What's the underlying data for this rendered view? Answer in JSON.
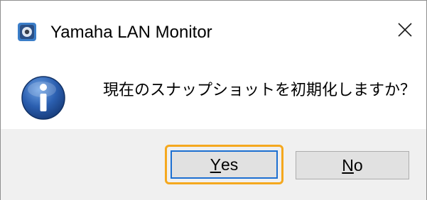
{
  "window": {
    "title": "Yamaha LAN Monitor",
    "app_icon": "yamaha-lan-monitor-app-icon",
    "close_icon": "close-x-icon"
  },
  "message": {
    "icon": "information-icon",
    "text": "現在のスナップショットを初期化しますか？"
  },
  "buttons": {
    "yes": {
      "mnemonic": "Y",
      "rest": "es"
    },
    "no": {
      "mnemonic": "N",
      "rest": "o"
    }
  },
  "colors": {
    "focus_ring": "#f5a81e",
    "default_button_border": "#1c6fd1",
    "footer_bg": "#f0f0f0",
    "info_icon_blue": "#2b5fb0"
  }
}
